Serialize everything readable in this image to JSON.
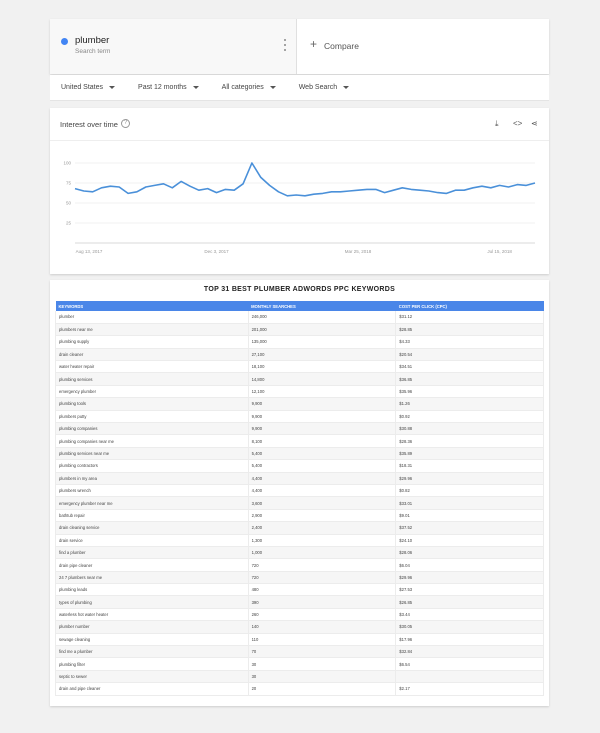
{
  "search": {
    "term": "plumber",
    "subtitle": "Search term",
    "compare_label": "Compare",
    "term_color": "#4285f4"
  },
  "filters": [
    "United States",
    "Past 12 months",
    "All categories",
    "Web Search"
  ],
  "interest": {
    "title": "Interest over time",
    "icons": [
      "help-icon",
      "download-icon",
      "embed-icon",
      "share-icon"
    ]
  },
  "chart_data": {
    "type": "line",
    "title": "Interest over time",
    "y_ticks": [
      "100",
      "75",
      "50",
      "25"
    ],
    "x_tick_labels": [
      "Aug 13, 2017",
      "Dec 3, 2017",
      "Mar 25, 2018",
      "Jul 15, 2018"
    ],
    "x_tick_index": [
      0,
      16,
      32,
      48
    ],
    "ylim": [
      0,
      100
    ],
    "color": "#4a90d9",
    "series": [
      {
        "values": [
          68,
          65,
          64,
          69,
          71,
          70,
          62,
          64,
          70,
          72,
          74,
          69,
          77,
          71,
          66,
          68,
          63,
          67,
          66,
          74,
          100,
          82,
          72,
          64,
          59,
          60,
          59,
          61,
          62,
          64,
          64,
          65,
          66,
          67,
          67,
          63,
          66,
          69,
          67,
          66,
          65,
          63,
          62,
          66,
          66,
          69,
          71,
          69,
          72,
          70,
          73,
          72,
          75
        ]
      }
    ]
  },
  "table": {
    "title": "TOP 31 BEST PLUMBER ADWORDS PPC KEYWORDS",
    "headers": [
      "KEYWORDS",
      "MONTHLY SEARCHES",
      "COST PER CLICK (CPC)"
    ],
    "rows": [
      [
        "plumber",
        "246,000",
        "$31.12"
      ],
      [
        "plumbers near me",
        "201,000",
        "$28.85"
      ],
      [
        "plumbing supply",
        "135,000",
        "$4.33"
      ],
      [
        "drain cleaner",
        "27,100",
        "$20.54"
      ],
      [
        "water heater repair",
        "18,100",
        "$34.51"
      ],
      [
        "plumbing services",
        "14,800",
        "$36.85"
      ],
      [
        "emergency plumber",
        "12,100",
        "$35.96"
      ],
      [
        "plumbing tools",
        "9,900",
        "$1.26"
      ],
      [
        "plumbers putty",
        "9,900",
        "$0.92"
      ],
      [
        "plumbing companies",
        "9,900",
        "$30.88"
      ],
      [
        "plumbing companies near me",
        "8,100",
        "$28.36"
      ],
      [
        "plumbing services near me",
        "5,400",
        "$35.89"
      ],
      [
        "plumbing contractors",
        "5,400",
        "$18.31"
      ],
      [
        "plumbers in my area",
        "4,400",
        "$29.96"
      ],
      [
        "plumbers wrench",
        "4,400",
        "$0.82"
      ],
      [
        "emergency plumber near me",
        "3,600",
        "$33.01"
      ],
      [
        "bathtub repair",
        "2,900",
        "$9.01"
      ],
      [
        "drain cleaning service",
        "2,400",
        "$37.52"
      ],
      [
        "drain service",
        "1,300",
        "$24.10"
      ],
      [
        "find a plumber",
        "1,000",
        "$28.06"
      ],
      [
        "drain pipe cleaner",
        "720",
        "$6.04"
      ],
      [
        "24 7 plumbers near me",
        "720",
        "$29.96"
      ],
      [
        "plumbing leads",
        "480",
        "$27.53"
      ],
      [
        "types of plumbing",
        "390",
        "$26.85"
      ],
      [
        "waterless hot water heater",
        "260",
        "$3.44"
      ],
      [
        "plumber number",
        "140",
        "$30.05"
      ],
      [
        "sewage cleaning",
        "110",
        "$17.96"
      ],
      [
        "find me a plumber",
        "70",
        "$32.84"
      ],
      [
        "plumbing filter",
        "30",
        "$6.54"
      ],
      [
        "septic to sewer",
        "30",
        ""
      ],
      [
        "drain and pipe cleaner",
        "20",
        "$2.17"
      ]
    ]
  }
}
